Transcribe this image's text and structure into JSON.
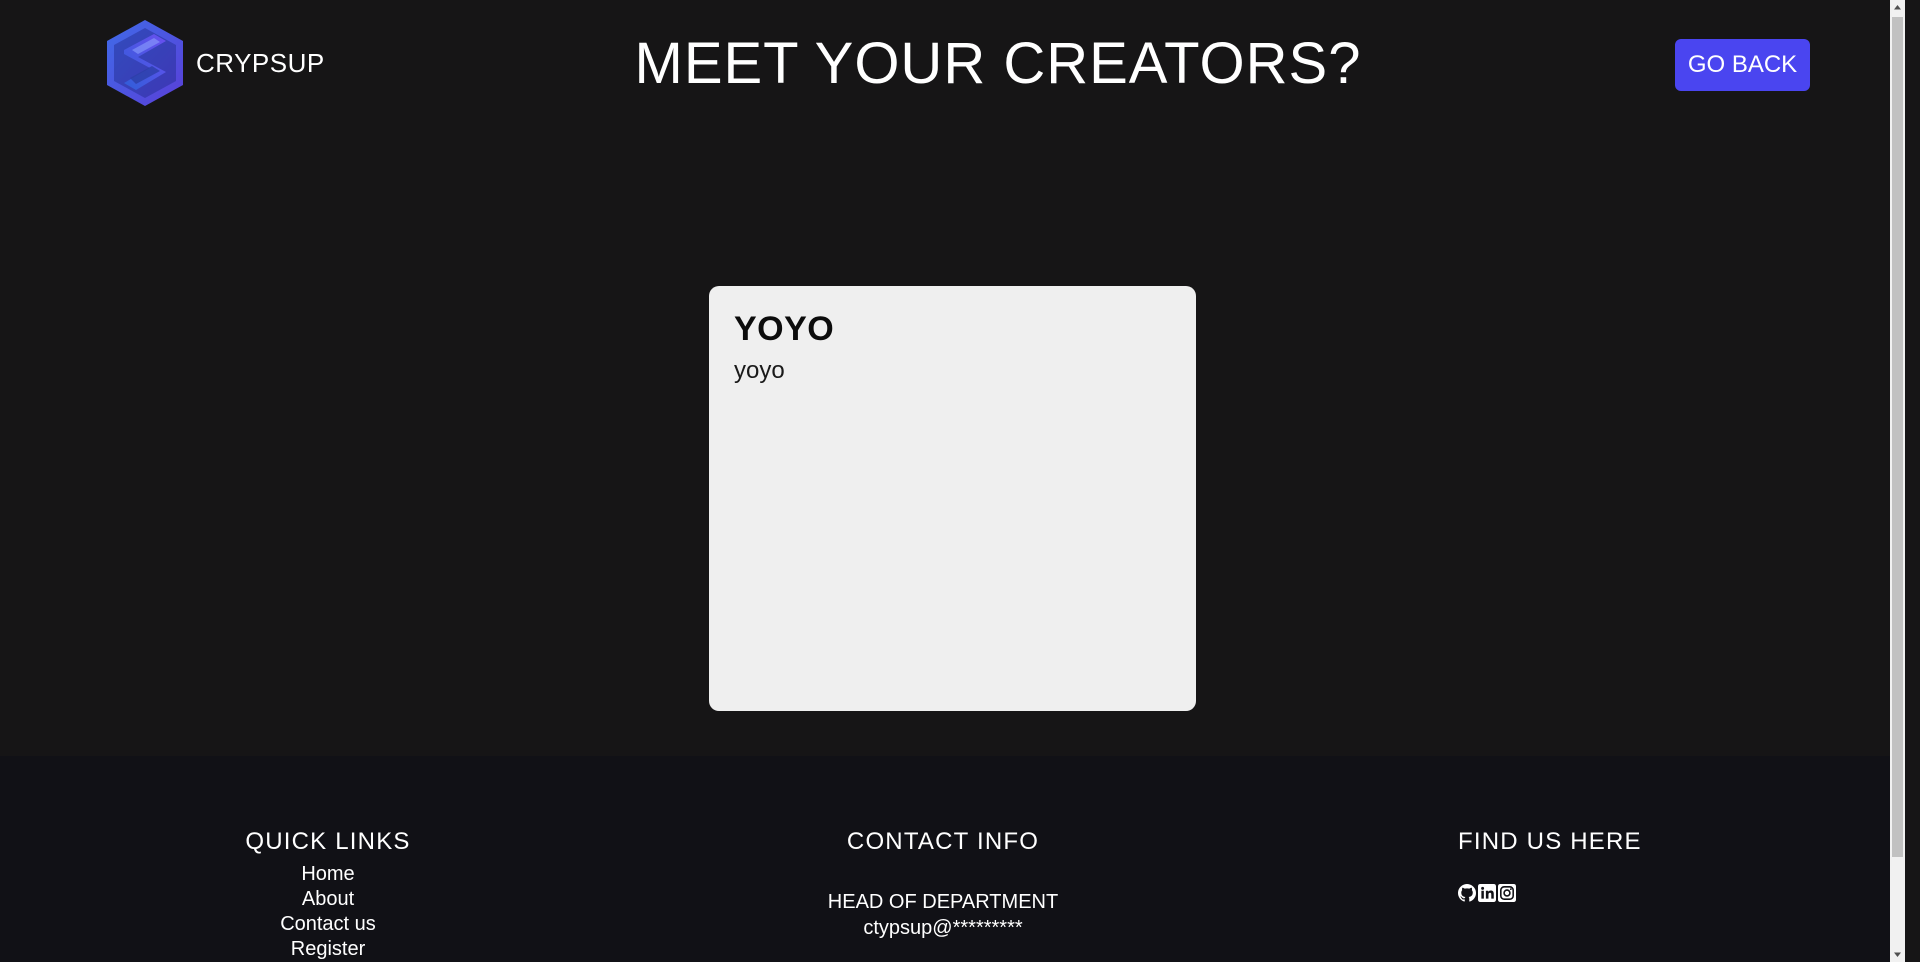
{
  "header": {
    "logo_text": "CRYPSUP",
    "title": "MEET YOUR CREATORS?",
    "go_back_label": "GO BACK"
  },
  "card": {
    "title": "YOYO",
    "description": "yoyo"
  },
  "footer": {
    "quick_links": {
      "heading": "QUICK LINKS",
      "items": [
        "Home",
        "About",
        "Contact us",
        "Register"
      ]
    },
    "contact": {
      "heading": "CONTACT INFO",
      "role": "HEAD OF DEPARTMENT",
      "email": "ctypsup@*********"
    },
    "find_us": {
      "heading": "FIND US HERE",
      "icons": [
        "github-icon",
        "linkedin-icon",
        "instagram-icon"
      ]
    }
  },
  "colors": {
    "background": "#161516",
    "footer_background": "#111116",
    "accent": "#4a45f0",
    "card": "#efefef"
  }
}
